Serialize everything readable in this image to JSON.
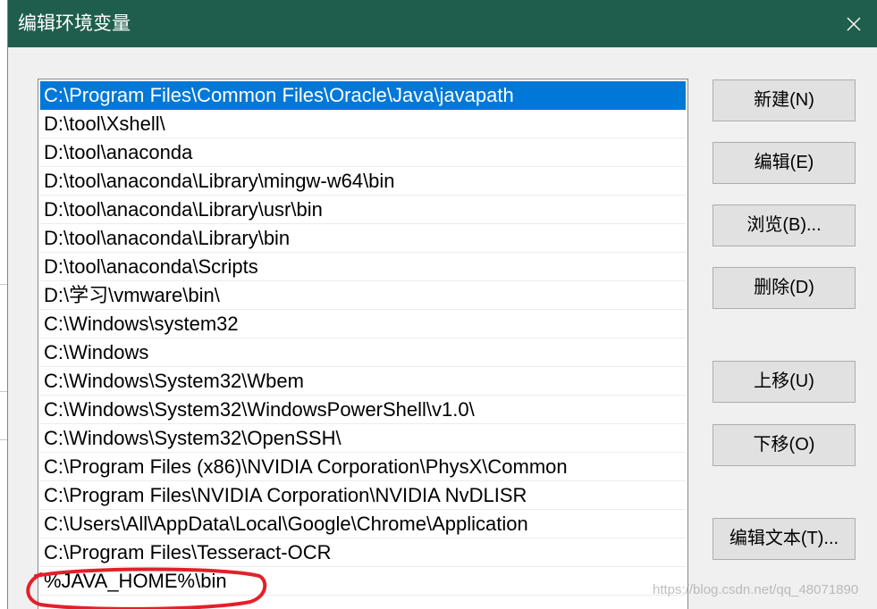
{
  "window": {
    "title": "编辑环境变量",
    "close_icon": "close-icon"
  },
  "path_list": {
    "selected_index": 0,
    "items": [
      "C:\\Program Files\\Common Files\\Oracle\\Java\\javapath",
      "D:\\tool\\Xshell\\",
      "D:\\tool\\anaconda",
      "D:\\tool\\anaconda\\Library\\mingw-w64\\bin",
      "D:\\tool\\anaconda\\Library\\usr\\bin",
      "D:\\tool\\anaconda\\Library\\bin",
      "D:\\tool\\anaconda\\Scripts",
      "D:\\学习\\vmware\\bin\\",
      "C:\\Windows\\system32",
      "C:\\Windows",
      "C:\\Windows\\System32\\Wbem",
      "C:\\Windows\\System32\\WindowsPowerShell\\v1.0\\",
      "C:\\Windows\\System32\\OpenSSH\\",
      "C:\\Program Files (x86)\\NVIDIA Corporation\\PhysX\\Common",
      "C:\\Program Files\\NVIDIA Corporation\\NVIDIA NvDLISR",
      "C:\\Users\\All\\AppData\\Local\\Google\\Chrome\\Application",
      "C:\\Program Files\\Tesseract-OCR",
      "%JAVA_HOME%\\bin"
    ]
  },
  "buttons": {
    "new": "新建(N)",
    "edit": "编辑(E)",
    "browse": "浏览(B)...",
    "delete": "删除(D)",
    "move_up": "上移(U)",
    "move_down": "下移(O)",
    "edit_text": "编辑文本(T)..."
  },
  "watermark": "https://blog.csdn.net/qq_48071890",
  "colors": {
    "title_bar": "#1f5e4d",
    "selection": "#0078d7",
    "annotation": "#e3202a"
  }
}
